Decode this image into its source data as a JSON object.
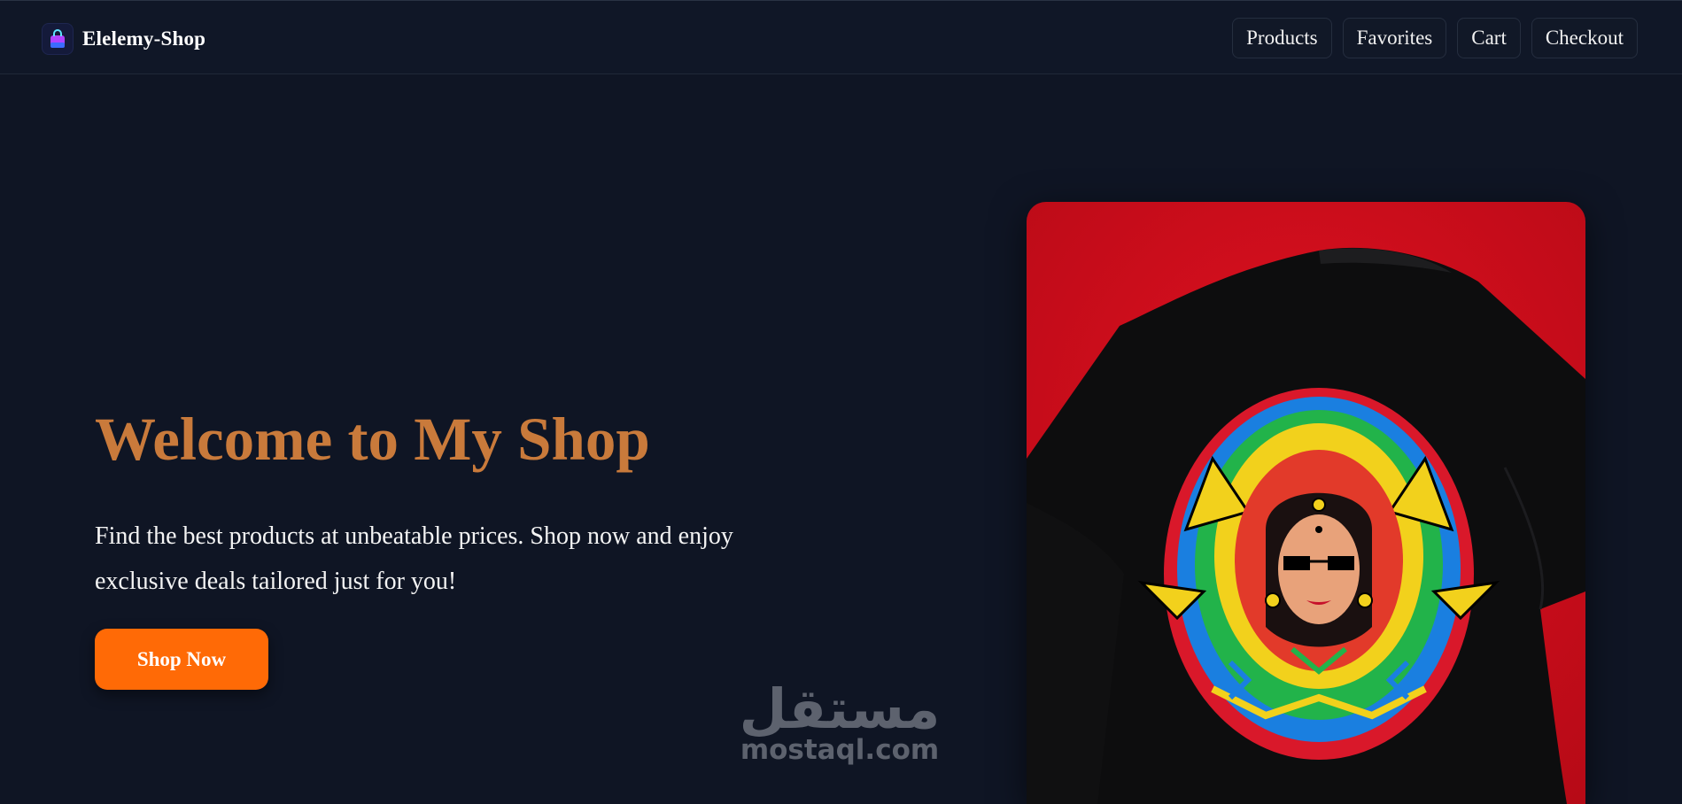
{
  "header": {
    "brand_name": "Elelemy-Shop",
    "logo_icon": "shopping-bag-icon",
    "nav": [
      {
        "label": "Products"
      },
      {
        "label": "Favorites"
      },
      {
        "label": "Cart"
      },
      {
        "label": "Checkout"
      }
    ]
  },
  "hero": {
    "title": "Welcome to My Shop",
    "description": "Find the best products at unbeatable prices. Shop now and enjoy exclusive deals tailored just for you!",
    "cta_label": "Shop Now",
    "image_subject": "black-tshirt-with-colorful-portrait-print"
  },
  "watermark": {
    "arabic": "مستقل",
    "latin": "mostaql.com"
  },
  "colors": {
    "background": "#0f1524",
    "title": "#c97a3b",
    "cta": "#ff6a06",
    "image_backdrop": "#d80f1e"
  }
}
